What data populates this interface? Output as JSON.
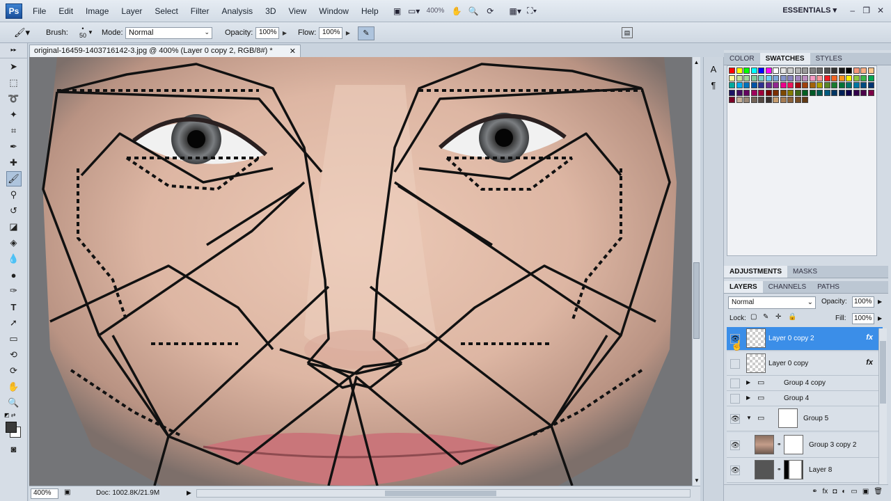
{
  "app": {
    "logo": "Ps",
    "workspace": "ESSENTIALS"
  },
  "menu": [
    "File",
    "Edit",
    "Image",
    "Layer",
    "Select",
    "Filter",
    "Analysis",
    "3D",
    "View",
    "Window",
    "Help"
  ],
  "toolbar": {
    "zoom": "400%"
  },
  "options": {
    "brush_label": "Brush:",
    "brush_size": "50",
    "mode_label": "Mode:",
    "mode_value": "Normal",
    "opacity_label": "Opacity:",
    "opacity_value": "100%",
    "flow_label": "Flow:",
    "flow_value": "100%"
  },
  "document": {
    "tab_title": "original-16459-1403716142-3.jpg @ 400% (Layer 0 copy 2, RGB/8#) *",
    "zoom": "400%",
    "doc_info": "Doc: 1002.8K/21.9M"
  },
  "panels": {
    "color_tabs": [
      "COLOR",
      "SWATCHES",
      "STYLES"
    ],
    "active_color_tab": "SWATCHES",
    "adjust_tabs": [
      "ADJUSTMENTS",
      "MASKS"
    ],
    "layers_tabs": [
      "LAYERS",
      "CHANNELS",
      "PATHS"
    ],
    "blend_mode": "Normal",
    "opacity_label": "Opacity:",
    "opacity_value": "100%",
    "lock_label": "Lock:",
    "fill_label": "Fill:",
    "fill_value": "100%"
  },
  "layers": [
    {
      "name": "Layer 0 copy 2",
      "selected": true,
      "visible": true,
      "fx": "fx"
    },
    {
      "name": "Layer 0 copy",
      "selected": false,
      "visible": false,
      "fx": "fx"
    },
    {
      "name": "Group 4 copy",
      "selected": false,
      "visible": false
    },
    {
      "name": "Group 4",
      "selected": false,
      "visible": false
    },
    {
      "name": "Group 5",
      "selected": false,
      "visible": true
    },
    {
      "name": "Group 3 copy 2",
      "selected": false,
      "visible": true
    },
    {
      "name": "Layer 8",
      "selected": false,
      "visible": true
    }
  ],
  "swatch_colors": [
    "#ff0000",
    "#ffff00",
    "#00ff00",
    "#00ffff",
    "#0000ff",
    "#ff00ff",
    "#ffffff",
    "#e6e6e6",
    "#cccccc",
    "#b3b3b3",
    "#999999",
    "#808080",
    "#666666",
    "#4d4d4d",
    "#333333",
    "#1a1a1a",
    "#000000",
    "#f7977a",
    "#f9ad81",
    "#fdc68a",
    "#fff79a",
    "#c4df9b",
    "#a2d39c",
    "#82ca9d",
    "#7bcdc8",
    "#6ecff6",
    "#7ea7d8",
    "#8493ca",
    "#8882be",
    "#a187be",
    "#bc8dbf",
    "#f49ac2",
    "#f6989d",
    "#ed1c24",
    "#f26522",
    "#f7941d",
    "#fff200",
    "#8dc73f",
    "#39b54a",
    "#00a651",
    "#00a99d",
    "#00aeef",
    "#0072bc",
    "#0054a6",
    "#2e3192",
    "#662d91",
    "#92278f",
    "#ec008c",
    "#ed145b",
    "#9e0b0f",
    "#a0410d",
    "#a36209",
    "#aba000",
    "#598527",
    "#1a7b30",
    "#007236",
    "#00746b",
    "#0076a3",
    "#004b80",
    "#003471",
    "#1b1464",
    "#440e62",
    "#630460",
    "#9e005d",
    "#9e0039",
    "#790000",
    "#7b2e00",
    "#7d4900",
    "#827b00",
    "#406618",
    "#005e20",
    "#005826",
    "#005952",
    "#005b7f",
    "#003663",
    "#002157",
    "#0d004c",
    "#32004b",
    "#4b0049",
    "#7b0046",
    "#7a0026",
    "#c7b299",
    "#998675",
    "#736357",
    "#534741",
    "#37302d",
    "#c69c6d",
    "#a67c52",
    "#8c6239",
    "#754c24",
    "#603913"
  ]
}
